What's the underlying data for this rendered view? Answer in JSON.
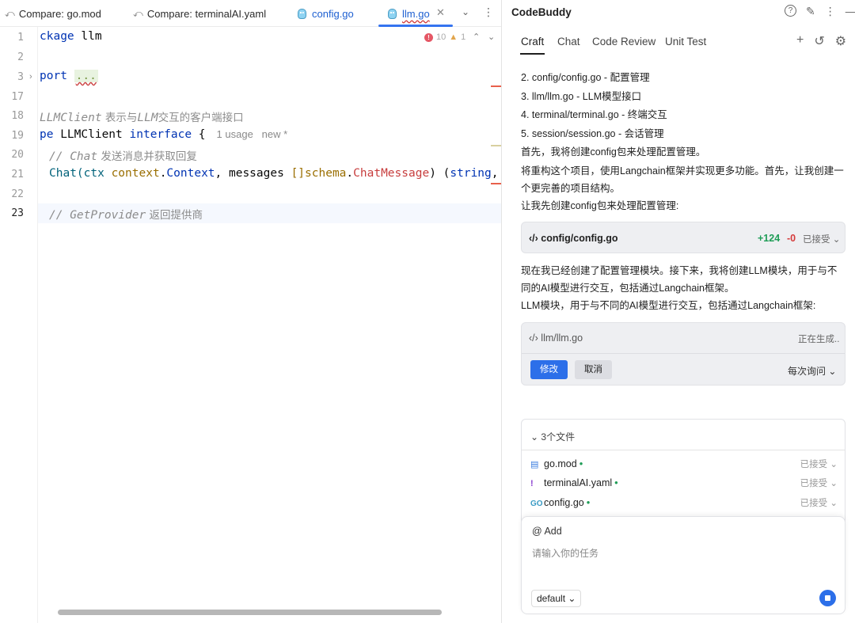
{
  "editor": {
    "tabs": [
      {
        "icon": "compare-icon",
        "label": "Compare: go.mod"
      },
      {
        "icon": "compare-icon",
        "label": "Compare: terminalAI.yaml"
      },
      {
        "icon": "go-file-icon",
        "label": "config.go"
      },
      {
        "icon": "go-file-icon",
        "label": "llm.go"
      }
    ],
    "problems": {
      "errors": "10",
      "warnings": "1"
    },
    "line_numbers": [
      "1",
      "2",
      "3",
      "17",
      "18",
      "19",
      "20",
      "21",
      "22",
      "23"
    ],
    "code": {
      "l1_kw": "ckage",
      "l1_name": " llm",
      "l3_kw": "port ",
      "l3_dots": "...",
      "l18_a": "LLMClient",
      "l18_b": " 表示与",
      "l18_c": "LLM",
      "l18_d": "交互的客户端接口",
      "l19_kw": "pe",
      "l19_name": " LLMClient ",
      "l19_kw2": "interface",
      "l19_brace": " {",
      "l19_hint": "1 usage   new *",
      "l20_a": "// Chat",
      "l20_b": " 发送消息并获取回复",
      "l21_fn": "Chat(ctx ",
      "l21_pkg": "context",
      "l21_dot": ".",
      "l21_typ": "Context",
      "l21_mid": ", messages ",
      "l21_br": "[]",
      "l21_pkg2": "schema",
      "l21_typ2": "ChatMessage",
      "l21_par": ") (",
      "l21_kw": "string",
      "l21_end": ", e",
      "l23_a": "// GetProvider",
      "l23_b": " 返回提供商"
    }
  },
  "panel": {
    "title": "CodeBuddy",
    "tabs": [
      "Craft",
      "Chat",
      "Code Review",
      "Unit Test"
    ],
    "messages": [
      "2. config/config.go - 配置管理",
      "3. llm/llm.go - LLM模型接口",
      "4. terminal/terminal.go - 终端交互",
      "5. session/session.go - 会话管理",
      "首先，我将创建config包来处理配置管理。",
      "将重构这个项目，使用Langchain框架并实现更多功能。首先，让我创建一个更完善的项目结构。",
      "让我先创建config包来处理配置管理:",
      "现在我已经创建了配置管理模块。接下来，我将创建LLM模块，用于与不同的AI模型进行交互，包括通过Langchain框架。",
      "LLM模块，用于与不同的AI模型进行交互，包括通过Langchain框架:"
    ],
    "card1": {
      "file": "config/config.go",
      "added": "+124",
      "removed": "-0",
      "status": "已接受"
    },
    "card2": {
      "file": "llm/llm.go",
      "status": "正在生成..",
      "modify": "修改",
      "cancel": "取消",
      "ask": "每次询问"
    },
    "files": {
      "header": "3个文件",
      "items": [
        {
          "name": "go.mod",
          "status": "已接受"
        },
        {
          "name": "terminalAI.yaml",
          "status": "已接受"
        },
        {
          "name": "config.go",
          "status": "已接受"
        }
      ]
    },
    "input": {
      "add": "@ Add",
      "placeholder": "请输入你的任务",
      "model": "default"
    }
  },
  "colors": {
    "accent": "#2c6fe9",
    "added": "#1f9d57",
    "removed": "#d53b3b",
    "keyword": "#0033b3"
  }
}
